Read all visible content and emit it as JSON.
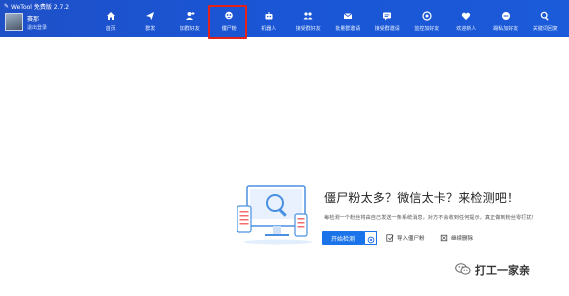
{
  "app": {
    "title": "WeTool 免费版 2.7.2"
  },
  "user": {
    "name": "赛那",
    "logout_label": "退出登录"
  },
  "nav": {
    "items": [
      {
        "label": "首页",
        "icon": "home-icon"
      },
      {
        "label": "群发",
        "icon": "send-icon"
      },
      {
        "label": "加群好友",
        "icon": "add-friend-icon"
      },
      {
        "label": "僵尸粉",
        "icon": "zombie-icon",
        "active": true
      },
      {
        "label": "机器人",
        "icon": "robot-icon"
      },
      {
        "label": "接受群好友",
        "icon": "accept-friend-icon"
      },
      {
        "label": "批量群邀请",
        "icon": "mail-icon"
      },
      {
        "label": "接受群邀请",
        "icon": "group-invite-icon"
      },
      {
        "label": "监控加好友",
        "icon": "monitor-icon"
      },
      {
        "label": "欢迎新人",
        "icon": "welcome-icon"
      },
      {
        "label": "踢私加好友",
        "icon": "kick-icon"
      },
      {
        "label": "关键词回复",
        "icon": "keyword-reply-icon"
      }
    ]
  },
  "main": {
    "headline": "僵尸粉太多？微信太卡？来检测吧！",
    "description": "每检测一个粉丝将由自己发送一条系统消息，对方不会收到任何提示，真正做到粉丝零打扰！",
    "start_button": "开始检测",
    "import_label": "导入僵尸粉",
    "clear_label": "继续删除"
  },
  "watermark": {
    "text": "打工一家亲"
  },
  "colors": {
    "header": "#1b55d2",
    "accent": "#1a73e8",
    "highlight": "#e2231a"
  }
}
